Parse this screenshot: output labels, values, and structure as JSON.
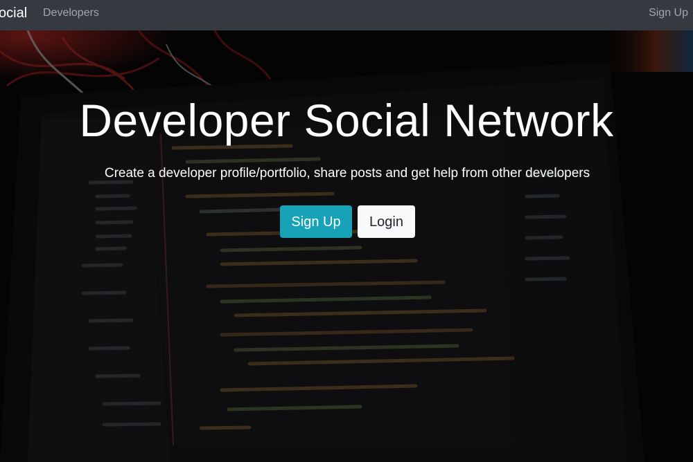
{
  "navbar": {
    "brand": "ocial",
    "links": {
      "developers": "Developers",
      "signup": "Sign Up"
    }
  },
  "hero": {
    "title": "Developer Social Network",
    "lead": "Create a developer profile/portfolio, share posts and get help from other developers",
    "buttons": {
      "signup": "Sign Up",
      "login": "Login"
    }
  },
  "colors": {
    "navbar_bg": "#343a40",
    "signup_button": "#17a2b8",
    "login_button": "#f8f9fa"
  }
}
